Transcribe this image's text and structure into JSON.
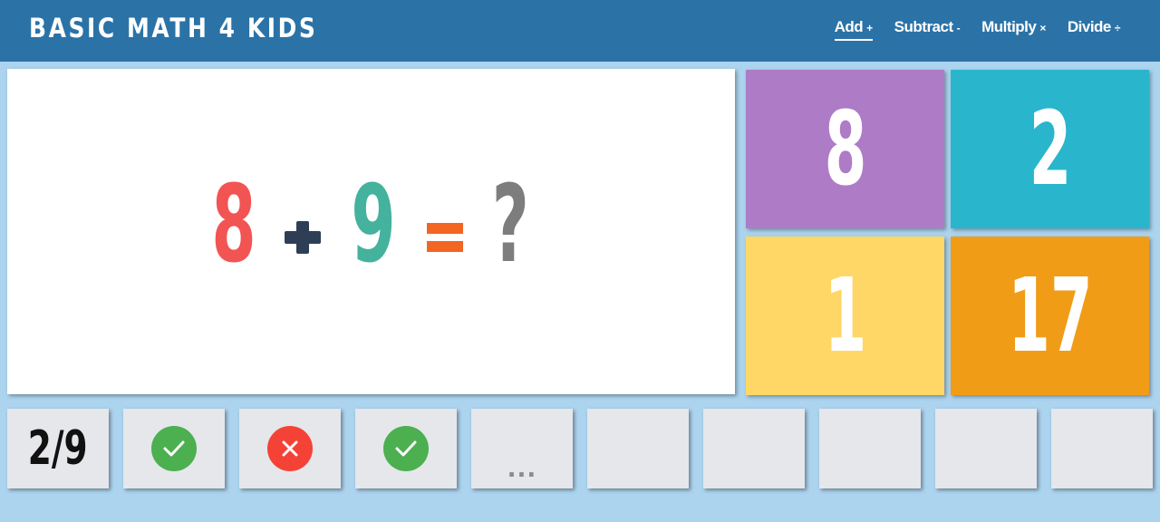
{
  "header": {
    "title": "BASIC MATH 4 KIDS",
    "nav": [
      {
        "label": "Add",
        "symbol": "+"
      },
      {
        "label": "Subtract",
        "symbol": "-"
      },
      {
        "label": "Multiply",
        "symbol": "×"
      },
      {
        "label": "Divide",
        "symbol": "÷"
      }
    ]
  },
  "question": {
    "operand_a": "8",
    "operator_icon": "plus-icon",
    "operand_b": "9",
    "equals_icon": "equals-icon",
    "unknown": "?"
  },
  "answers": [
    {
      "value": "8",
      "color": "#ae7bc6"
    },
    {
      "value": "2",
      "color": "#29b6cc"
    },
    {
      "value": "1",
      "color": "#ffd766"
    },
    {
      "value": "17",
      "color": "#f19c17"
    }
  ],
  "progress": {
    "score": "2/9",
    "results": [
      {
        "status": "correct",
        "icon": "check-icon",
        "color": "#4caf50"
      },
      {
        "status": "wrong",
        "icon": "x-icon",
        "color": "#f44336"
      },
      {
        "status": "correct",
        "icon": "check-icon",
        "color": "#4caf50"
      },
      {
        "status": "current",
        "text": "..."
      }
    ]
  }
}
